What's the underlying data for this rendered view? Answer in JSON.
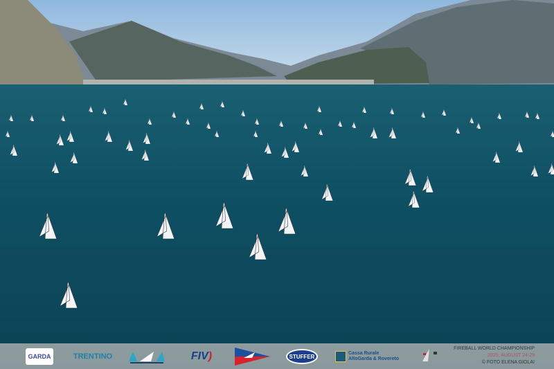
{
  "photo": {
    "subject": "sailboat regatta on lake",
    "colors": {
      "sky": "#a9cbe6",
      "lake": "#0f4d62",
      "mountains": "#6e7a80",
      "sponsor_bar": "#8c9b9d"
    }
  },
  "sponsors": {
    "garda": "GARDA",
    "trentino": "TRENTINO",
    "fiv": "FIV",
    "stuffer": "STUFFER",
    "cassa_line1": "Cassa Rurale",
    "cassa_line2": "AltoGarda & Rovereto"
  },
  "event": {
    "title": "FIREBALL WORLD CHAMPIONSHIP",
    "dates": "2025, AUGUST 24-29",
    "credit": "© FOTO ELENA GIOLAI"
  }
}
